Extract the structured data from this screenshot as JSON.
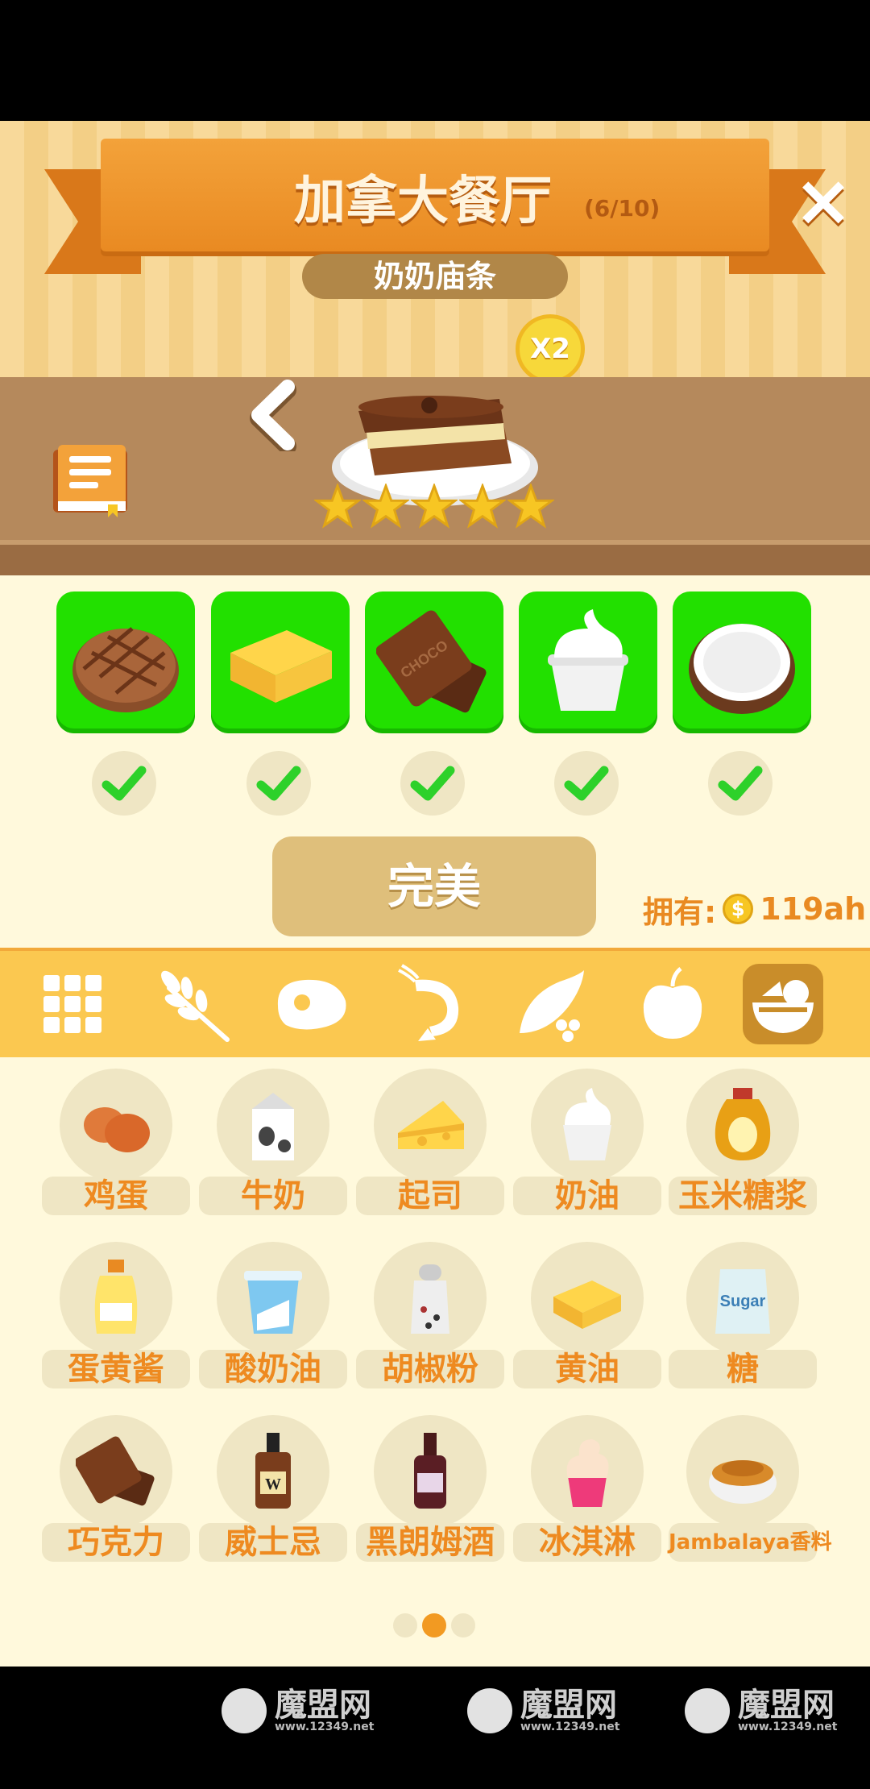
{
  "header": {
    "title": "加拿大餐厅",
    "progress": "(6/10)",
    "close_icon": "×",
    "dish_name": "奶奶庙条",
    "multiplier": "X2"
  },
  "dish": {
    "stars": 5,
    "star_color": "#f7c623"
  },
  "recipe": {
    "slots": [
      "bread-icon",
      "butter-icon",
      "chocolate-icon",
      "cream-icon",
      "coconut-icon"
    ],
    "checked": [
      true,
      true,
      true,
      true,
      true
    ],
    "result_label": "完美",
    "owned_label": "拥有:",
    "coin_symbol": "$",
    "owned_value": "119ah",
    "slot_color": "#22e000"
  },
  "categories": [
    "grid-icon",
    "wheat-icon",
    "meat-icon",
    "shrimp-icon",
    "peas-icon",
    "apple-icon",
    "bowl-icon"
  ],
  "active_category": "bowl-icon",
  "ingredients": [
    {
      "label": "鸡蛋",
      "icon": "eggs-icon"
    },
    {
      "label": "牛奶",
      "icon": "milk-icon"
    },
    {
      "label": "起司",
      "icon": "cheese-icon"
    },
    {
      "label": "奶油",
      "icon": "cream-icon"
    },
    {
      "label": "玉米糖浆",
      "icon": "corn-syrup-icon"
    },
    {
      "label": "蛋黄酱",
      "icon": "mayo-icon"
    },
    {
      "label": "酸奶油",
      "icon": "sour-cream-icon"
    },
    {
      "label": "胡椒粉",
      "icon": "pepper-icon"
    },
    {
      "label": "黄油",
      "icon": "butter-icon"
    },
    {
      "label": "糖",
      "icon": "sugar-icon"
    },
    {
      "label": "巧克力",
      "icon": "chocolate-icon"
    },
    {
      "label": "威士忌",
      "icon": "whisky-icon"
    },
    {
      "label": "黑朗姆酒",
      "icon": "rum-icon"
    },
    {
      "label": "冰淇淋",
      "icon": "ice-cream-icon"
    },
    {
      "label": "Jambalaya香料",
      "icon": "spice-icon"
    }
  ],
  "pagination": {
    "pages": 3,
    "current": 2
  },
  "watermark": {
    "text": "魔盟网",
    "url": "www.12349.net"
  }
}
